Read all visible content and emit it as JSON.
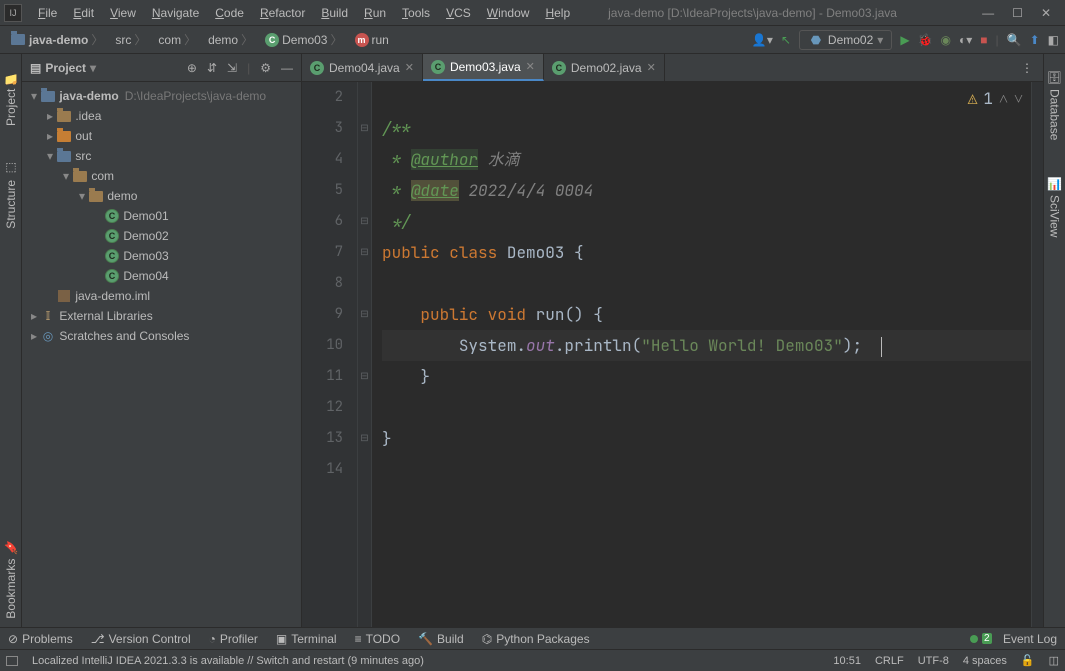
{
  "title": "java-demo [D:\\IdeaProjects\\java-demo] - Demo03.java",
  "menu": {
    "file": "File",
    "edit": "Edit",
    "view": "View",
    "navigate": "Navigate",
    "code": "Code",
    "refactor": "Refactor",
    "build": "Build",
    "run": "Run",
    "tools": "Tools",
    "vcs": "VCS",
    "window": "Window",
    "help": "Help"
  },
  "breadcrumb": {
    "project": "java-demo",
    "src": "src",
    "pkg1": "com",
    "pkg2": "demo",
    "class": "Demo03",
    "method": "run"
  },
  "run_config": "Demo02",
  "left_tabs": {
    "project": "Project",
    "structure": "Structure",
    "bookmarks": "Bookmarks"
  },
  "right_tabs": {
    "database": "Database",
    "sciview": "SciView"
  },
  "panel": {
    "title": "Project",
    "tree": {
      "root": "java-demo",
      "root_hint": "D:\\IdeaProjects\\java-demo",
      "idea": ".idea",
      "out": "out",
      "src": "src",
      "com": "com",
      "demo": "demo",
      "d1": "Demo01",
      "d2": "Demo02",
      "d3": "Demo03",
      "d4": "Demo04",
      "iml": "java-demo.iml",
      "ext": "External Libraries",
      "scratch": "Scratches and Consoles"
    }
  },
  "tabs": {
    "t1": "Demo04.java",
    "t2": "Demo03.java",
    "t3": "Demo02.java"
  },
  "warn": {
    "count": "1"
  },
  "code": {
    "l2": "",
    "l3": "/**",
    "l4a": " * ",
    "l4b": "@author",
    "l4c": " 水滴",
    "l5a": " * ",
    "l5b": "@date",
    "l5c": " 2022/4/4 0004",
    "l6": " */",
    "l7a": "public",
    "l7b": "class",
    "l7c": "Demo03",
    "l8": "",
    "l9a": "public",
    "l9b": "void",
    "l9c": "run",
    "l10a": "System.",
    "l10b": "out",
    "l10c": ".println(",
    "l10d": "\"Hello World! Demo03\"",
    "l10e": ");",
    "l11": "    }",
    "l12": "",
    "l13": "}",
    "l14": ""
  },
  "gutter": {
    "n2": "2",
    "n3": "3",
    "n4": "4",
    "n5": "5",
    "n6": "6",
    "n7": "7",
    "n8": "8",
    "n9": "9",
    "n10": "10",
    "n11": "11",
    "n12": "12",
    "n13": "13",
    "n14": "14"
  },
  "bottom": {
    "problems": "Problems",
    "vcs": "Version Control",
    "profiler": "Profiler",
    "terminal": "Terminal",
    "todo": "TODO",
    "build": "Build",
    "python": "Python Packages",
    "event_log": "Event Log",
    "event_count": "2"
  },
  "status": {
    "msg": "Localized IntelliJ IDEA 2021.3.3 is available // Switch and restart (9 minutes ago)",
    "pos": "10:51",
    "eol": "CRLF",
    "enc": "UTF-8",
    "indent": "4 spaces"
  }
}
